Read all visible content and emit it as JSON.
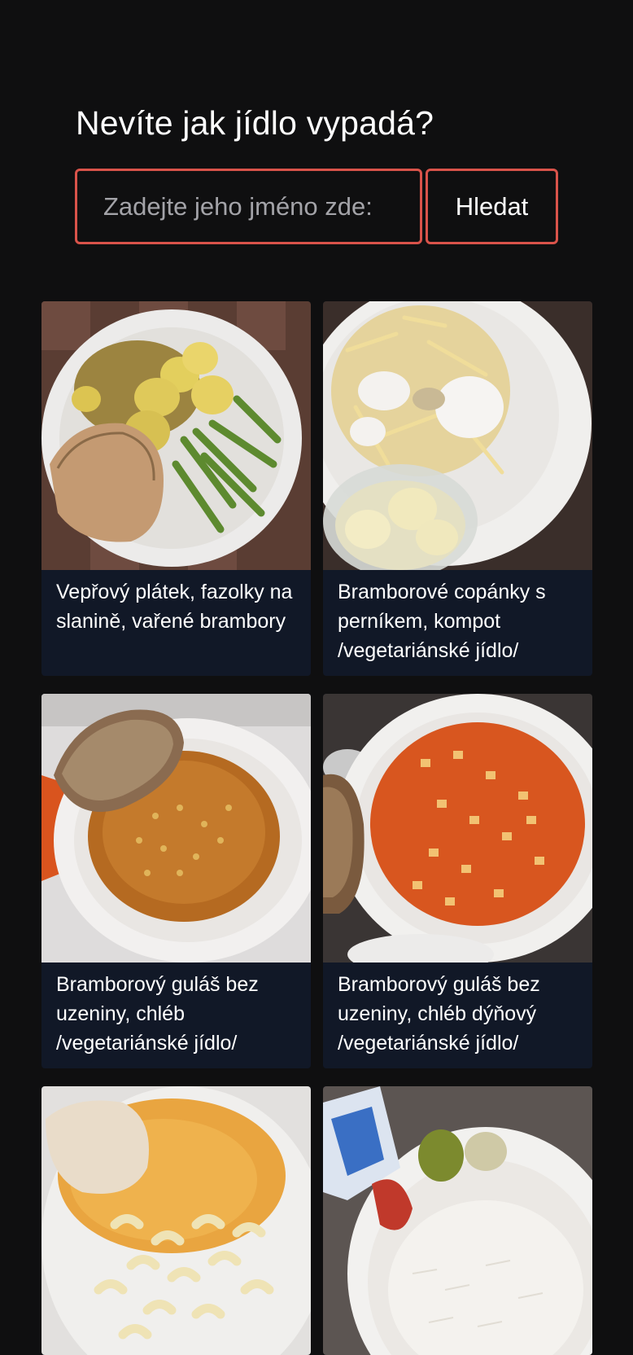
{
  "search": {
    "heading": "Nevíte jak jídlo vypadá?",
    "placeholder": "Zadejte jeho jméno zde:",
    "button_label": "Hledat"
  },
  "meals": [
    {
      "caption": "Vepřový plátek, fazolky na slanině, vařené brambory"
    },
    {
      "caption": "Bramborové copánky s perníkem, kompot /vegetariánské jídlo/"
    },
    {
      "caption": "Bramborový guláš bez uzeniny, chléb /vegetariánské jídlo/"
    },
    {
      "caption": "Bramborový guláš bez uzeniny, chléb dýňový /vegetariánské jídlo/"
    },
    {
      "caption": ""
    },
    {
      "caption": ""
    }
  ],
  "colors": {
    "background": "#0f0f10",
    "card": "#111827",
    "accent_border": "#d9534a"
  }
}
